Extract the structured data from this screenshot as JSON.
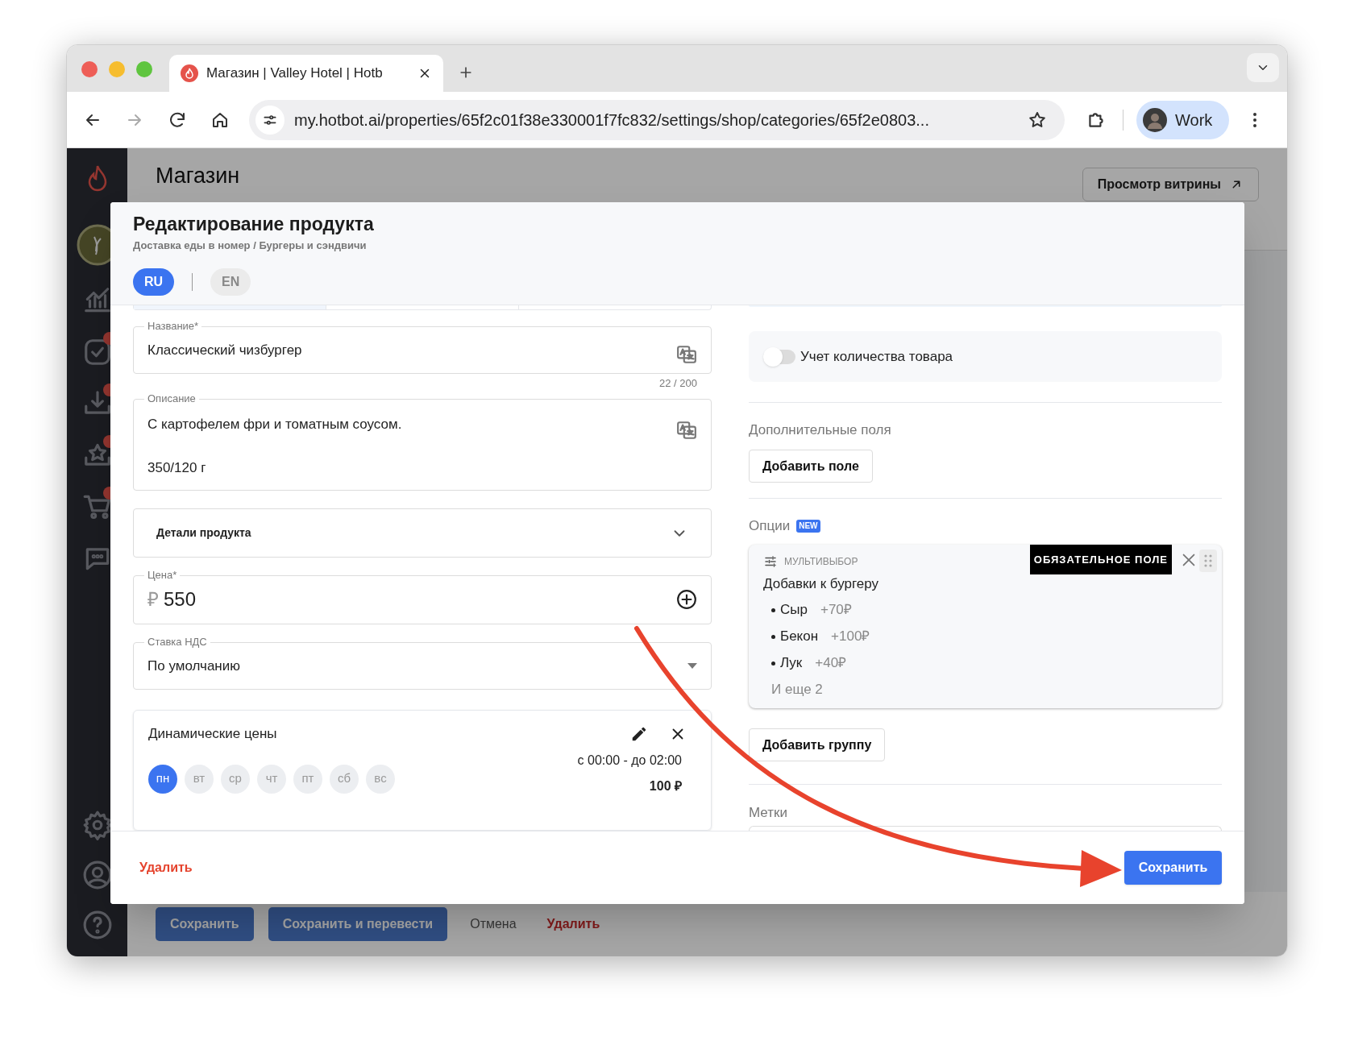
{
  "browser": {
    "tab_title": "Магазин | Valley Hotel | Hotb",
    "url": "my.hotbot.ai/properties/65f2c01f38e330001f7fc832/settings/shop/categories/65f2e0803...",
    "profile": "Work"
  },
  "sidebar": {
    "top_items": [
      {
        "badge": false
      },
      {
        "badge": true
      },
      {
        "badge": true
      },
      {
        "badge": true
      },
      {
        "badge": true
      },
      {
        "badge": false
      }
    ],
    "bottom_items": [
      {
        "badge": false
      },
      {
        "badge": false
      },
      {
        "badge": false
      }
    ]
  },
  "page": {
    "title": "Магазин",
    "storefront_button": "Просмотр витрины",
    "actions": [
      {
        "label": "Сохранить",
        "kind": "primary"
      },
      {
        "label": "Сохранить и перевести",
        "kind": "primary"
      },
      {
        "label": "Отмена",
        "kind": "plain"
      },
      {
        "label": "Удалить",
        "kind": "danger"
      }
    ]
  },
  "modal": {
    "title": "Редактирование продукта",
    "breadcrumb": "Доставка еды в номер / Бургеры и сэндвичи",
    "languages": [
      {
        "label": "RU",
        "selected": true
      },
      {
        "label": "EN",
        "selected": false
      }
    ],
    "name_field": {
      "label": "Название*",
      "value": "Классический чизбургер",
      "counter": "22 / 200"
    },
    "description_field": {
      "label": "Описание",
      "lines": [
        "С картофелем фри и томатным соусом.",
        "350/120 г"
      ]
    },
    "details": {
      "label": "Детали продукта",
      "expanded": false
    },
    "price_field": {
      "label": "Цена*",
      "currency": "₽",
      "value": "550"
    },
    "vat_field": {
      "label": "Ставка НДС",
      "value": "По умолчанию"
    },
    "dynamic_prices": {
      "title": "Динамические цены",
      "days": [
        {
          "label": "пн",
          "selected": true
        },
        {
          "label": "вт",
          "selected": false
        },
        {
          "label": "ср",
          "selected": false
        },
        {
          "label": "чт",
          "selected": false
        },
        {
          "label": "пт",
          "selected": false
        },
        {
          "label": "сб",
          "selected": false
        },
        {
          "label": "вс",
          "selected": false
        }
      ],
      "time": "с 00:00 - до 02:00",
      "price": "100 ₽"
    },
    "stock_toggle": {
      "label": "Учет количества товара",
      "on": false
    },
    "extra_fields": {
      "title": "Дополнительные поля",
      "button": "Добавить поле"
    },
    "options": {
      "title": "Опции",
      "badge": "NEW",
      "group": {
        "type": "МУЛЬТИВЫБОР",
        "required": "ОБЯЗАТЕЛЬНОЕ ПОЛЕ",
        "name": "Добавки к бургеру",
        "items": [
          {
            "name": "Сыр",
            "price": "+70₽"
          },
          {
            "name": "Бекон",
            "price": "+100₽"
          },
          {
            "name": "Лук",
            "price": "+40₽"
          }
        ],
        "more": "И еще 2"
      },
      "button": "Добавить группу"
    },
    "tags": {
      "title": "Метки"
    },
    "footer": {
      "delete": "Удалить",
      "save": "Сохранить"
    }
  }
}
